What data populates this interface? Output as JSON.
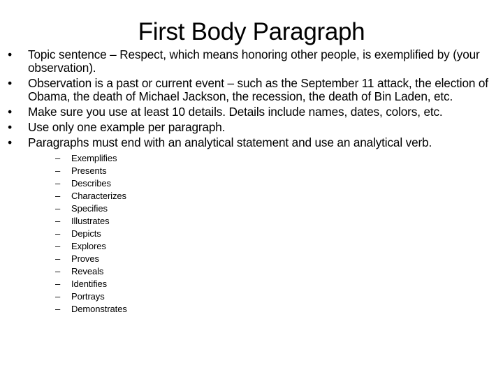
{
  "slide": {
    "title": "First Body Paragraph",
    "bullet_glyph": "•",
    "dash_glyph": "–",
    "bullets": [
      {
        "text": "Topic sentence – Respect, which means honoring other people, is exemplified by (your observation)."
      },
      {
        "text": "Observation is a past or current event – such as the September 11 attack, the election of Obama, the death of Michael Jackson, the recession, the death of Bin Laden, etc."
      },
      {
        "text": "Make sure you use at least 10 details.  Details include names, dates, colors, etc."
      },
      {
        "text": "Use only one example per paragraph."
      },
      {
        "text": "Paragraphs must end with an analytical statement and use an analytical verb."
      }
    ],
    "verbs": [
      "Exemplifies",
      "Presents",
      "Describes",
      "Characterizes",
      "Specifies",
      "Illustrates",
      "Depicts",
      "Explores",
      "Proves",
      "Reveals",
      "Identifies",
      "Portrays",
      "Demonstrates"
    ]
  }
}
